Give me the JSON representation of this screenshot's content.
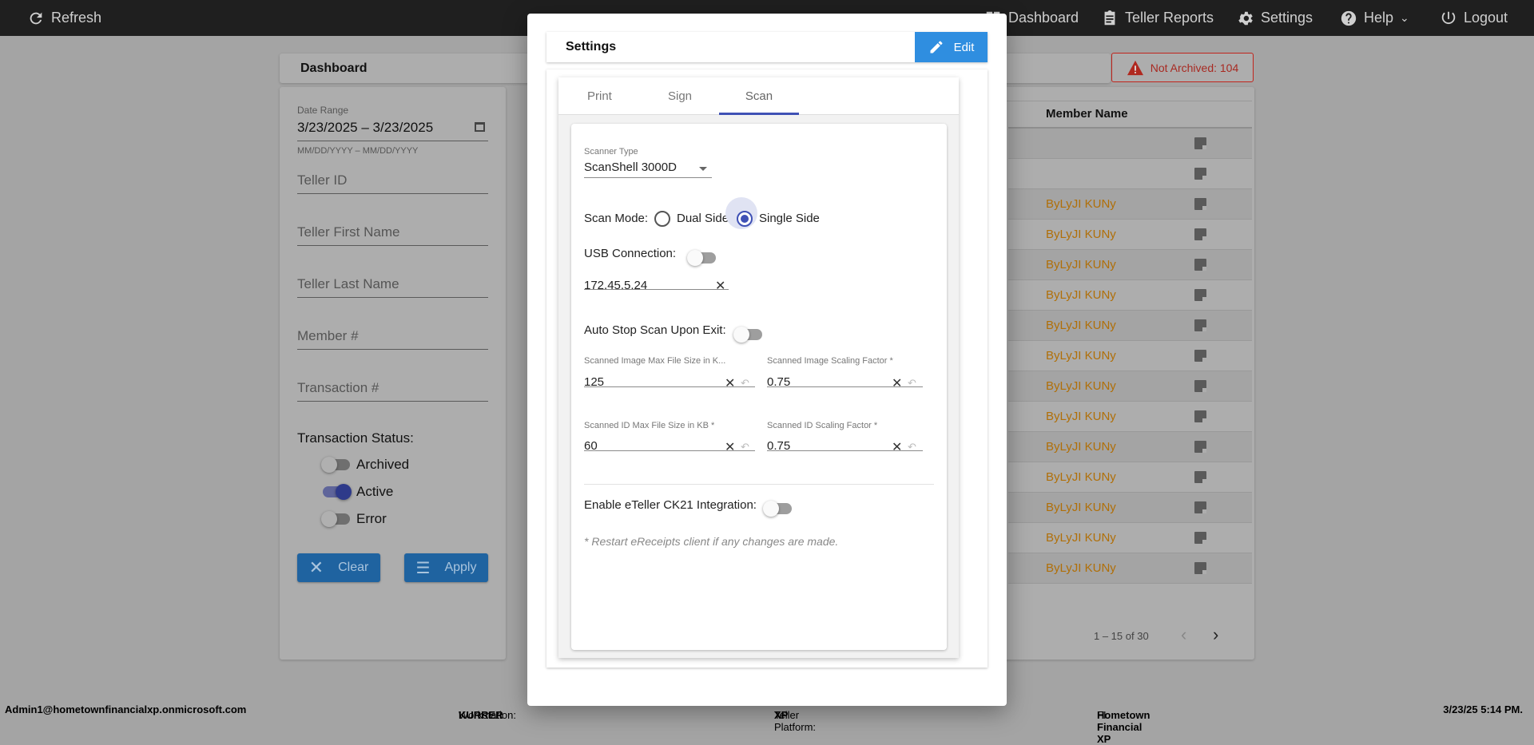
{
  "topbar": {
    "refresh": "Refresh",
    "nav": [
      "Dashboard",
      "Teller Reports",
      "Settings",
      "Help",
      "Logout"
    ]
  },
  "dashboard": {
    "title": "Dashboard",
    "badge": "Not Archived: 104"
  },
  "filters": {
    "date_label": "Date Range",
    "date_value": "3/23/2025 – 3/23/2025",
    "date_hint": "MM/DD/YYYY – MM/DD/YYYY",
    "fields": [
      "Teller ID",
      "Teller First Name",
      "Teller Last Name",
      "Member #",
      "Transaction #"
    ],
    "status_label": "Transaction Status:",
    "statuses": [
      {
        "label": "Archived",
        "on": false
      },
      {
        "label": "Active",
        "on": true
      },
      {
        "label": "Error",
        "on": false
      }
    ],
    "clear": "Clear",
    "apply": "Apply"
  },
  "table": {
    "header": "Member Name",
    "rows": [
      "",
      "",
      "ByLyJI KUNy",
      "ByLyJI KUNy",
      "ByLyJI KUNy",
      "ByLyJI KUNy",
      "ByLyJI KUNy",
      "ByLyJI KUNy",
      "ByLyJI KUNy",
      "ByLyJI KUNy",
      "ByLyJI KUNy",
      "ByLyJI KUNy",
      "ByLyJI KUNy",
      "ByLyJI KUNy",
      "ByLyJI KUNy"
    ],
    "pagination": "1 – 15 of 30"
  },
  "footer": {
    "user": "Admin1@hometownfinancialxp.onmicrosoft.com",
    "workstation_label": "Workstation:",
    "workstation": "KURRER",
    "platform_label": "Teller Platform:",
    "platform": "XP",
    "fi_label": "FI:",
    "fi": "Hometown Financial XP",
    "datetime": "3/23/25 5:14 PM."
  },
  "modal": {
    "title": "Settings",
    "edit": "Edit",
    "tabs": [
      "Print",
      "Sign",
      "Scan"
    ],
    "active_tab": "Scan",
    "scanner_type_label": "Scanner Type",
    "scanner_type": "ScanShell 3000D",
    "scan_mode_label": "Scan Mode:",
    "scan_mode_options": [
      "Dual Side",
      "Single Side"
    ],
    "scan_mode": "Single Side",
    "usb_label": "USB Connection:",
    "usb_on": false,
    "ip": "172.45.5.24",
    "auto_stop_label": "Auto Stop Scan Upon Exit:",
    "auto_stop_on": false,
    "img_max_label": "Scanned Image Max File Size in K...",
    "img_max": "125",
    "img_scale_label": "Scanned Image Scaling Factor *",
    "img_scale": "0.75",
    "id_max_label": "Scanned ID Max File Size in KB *",
    "id_max": "60",
    "id_scale_label": "Scanned ID Scaling Factor *",
    "id_scale": "0.75",
    "eteller_label": "Enable eTeller CK21 Integration:",
    "eteller_on": false,
    "note": "* Restart eReceipts client if any changes are made."
  }
}
